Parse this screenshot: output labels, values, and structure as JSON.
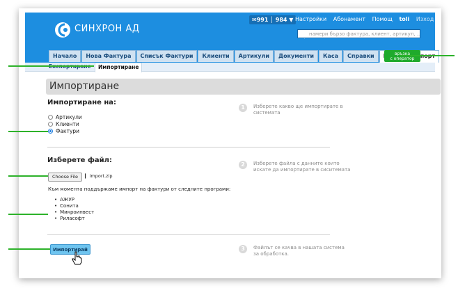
{
  "header": {
    "logo_text": "СИНХРОН АД",
    "phone": "✉991 │ 984 ▼",
    "top_links": [
      "Настройки",
      "Абонамент",
      "Помощ"
    ],
    "user": "toli",
    "logout": "Изход",
    "search_placeholder": "намери бързо фактура, клиент, артикул, ...",
    "operator": {
      "line1": "връзка",
      "line2": "с оператор"
    }
  },
  "tabs": [
    "Начало",
    "Нова Фактура",
    "Списък Фактури",
    "Клиенти",
    "Артикули",
    "Документи",
    "Каса",
    "Справки",
    "Импорт/експорт"
  ],
  "active_tab": "Импорт/експорт",
  "subtabs": {
    "export": "Експортиране",
    "import": "Импортиране"
  },
  "main": {
    "title": "Импортиране",
    "import_to_label": "Импортиране на:",
    "options": [
      "Артикули",
      "Клиенти",
      "Фактури"
    ],
    "selected_option": "Фактури",
    "file_label": "Изберете файл:",
    "choose_file_button": "Choose File",
    "file_name": "import.zip",
    "supported_notice": "Към момента поддържаме импорт на фактури от следните програми:",
    "programs": [
      "АЖУР",
      "Сонита",
      "Микроинвест",
      "Риласофт"
    ],
    "import_button": "Импортирай"
  },
  "steps": [
    {
      "num": "1",
      "text": "Изберете какво ще импортирате в системата"
    },
    {
      "num": "2",
      "text": "Изберете файла с данните които искате да импортирате в сиситемата"
    },
    {
      "num": "3",
      "text": "Файлът се качва в нашата система за обработка."
    }
  ],
  "colors": {
    "header_blue": "#1d8ee0",
    "annotation_green": "#2db22a",
    "operator_green": "#1faa2c",
    "button_blue": "#6ec4ef"
  }
}
